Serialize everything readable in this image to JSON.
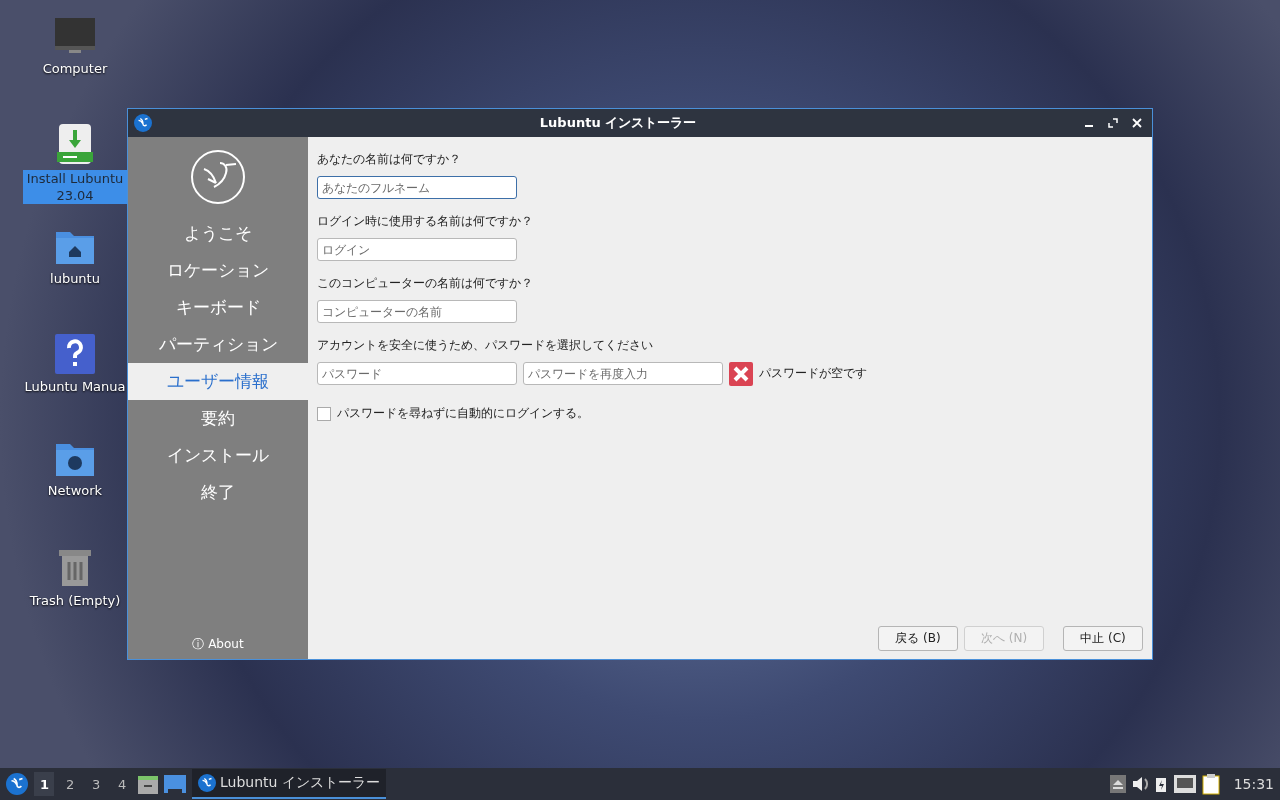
{
  "desktop_icons": [
    {
      "label": "Computer",
      "kind": "computer",
      "selected": false
    },
    {
      "label": "Install Lubuntu 23.04",
      "kind": "installer",
      "selected": true
    },
    {
      "label": "lubuntu",
      "kind": "home",
      "selected": false
    },
    {
      "label": "Lubuntu Manua",
      "kind": "help",
      "selected": false
    },
    {
      "label": "Network",
      "kind": "network",
      "selected": false
    },
    {
      "label": "Trash (Empty)",
      "kind": "trash",
      "selected": false
    }
  ],
  "window": {
    "title": "Lubuntu インストーラー",
    "sidebar": {
      "steps": [
        {
          "label": "ようこそ",
          "selected": false
        },
        {
          "label": "ロケーション",
          "selected": false
        },
        {
          "label": "キーボード",
          "selected": false
        },
        {
          "label": "パーティション",
          "selected": false
        },
        {
          "label": "ユーザー情報",
          "selected": true
        },
        {
          "label": "要約",
          "selected": false
        },
        {
          "label": "インストール",
          "selected": false
        },
        {
          "label": "終了",
          "selected": false
        }
      ],
      "about": "ⓘ About"
    },
    "form": {
      "name_label": "あなたの名前は何ですか？",
      "name_placeholder": "あなたのフルネーム",
      "login_label": "ログイン時に使用する名前は何ですか？",
      "login_placeholder": "ログイン",
      "computer_label": "このコンピューターの名前は何ですか？",
      "computer_placeholder": "コンピューターの名前",
      "password_label": "アカウントを安全に使うため、パスワードを選択してください",
      "password_placeholder": "パスワード",
      "repeat_placeholder": "パスワードを再度入力",
      "password_error": "パスワードが空です",
      "autologin": {
        "label": "パスワードを尋ねずに自動的にログインする。",
        "checked": false
      }
    },
    "buttons": [
      {
        "label": "戻る (B)",
        "disabled": false
      },
      {
        "label": "次へ (N)",
        "disabled": true
      },
      {
        "label": "中止 (C)",
        "disabled": false
      }
    ]
  },
  "taskbar": {
    "workspaces": [
      {
        "label": "1",
        "selected": true
      },
      {
        "label": "2",
        "selected": false
      },
      {
        "label": "3",
        "selected": false
      },
      {
        "label": "4",
        "selected": false
      }
    ],
    "task": "Lubuntu インストーラー",
    "clock": "15:31"
  }
}
